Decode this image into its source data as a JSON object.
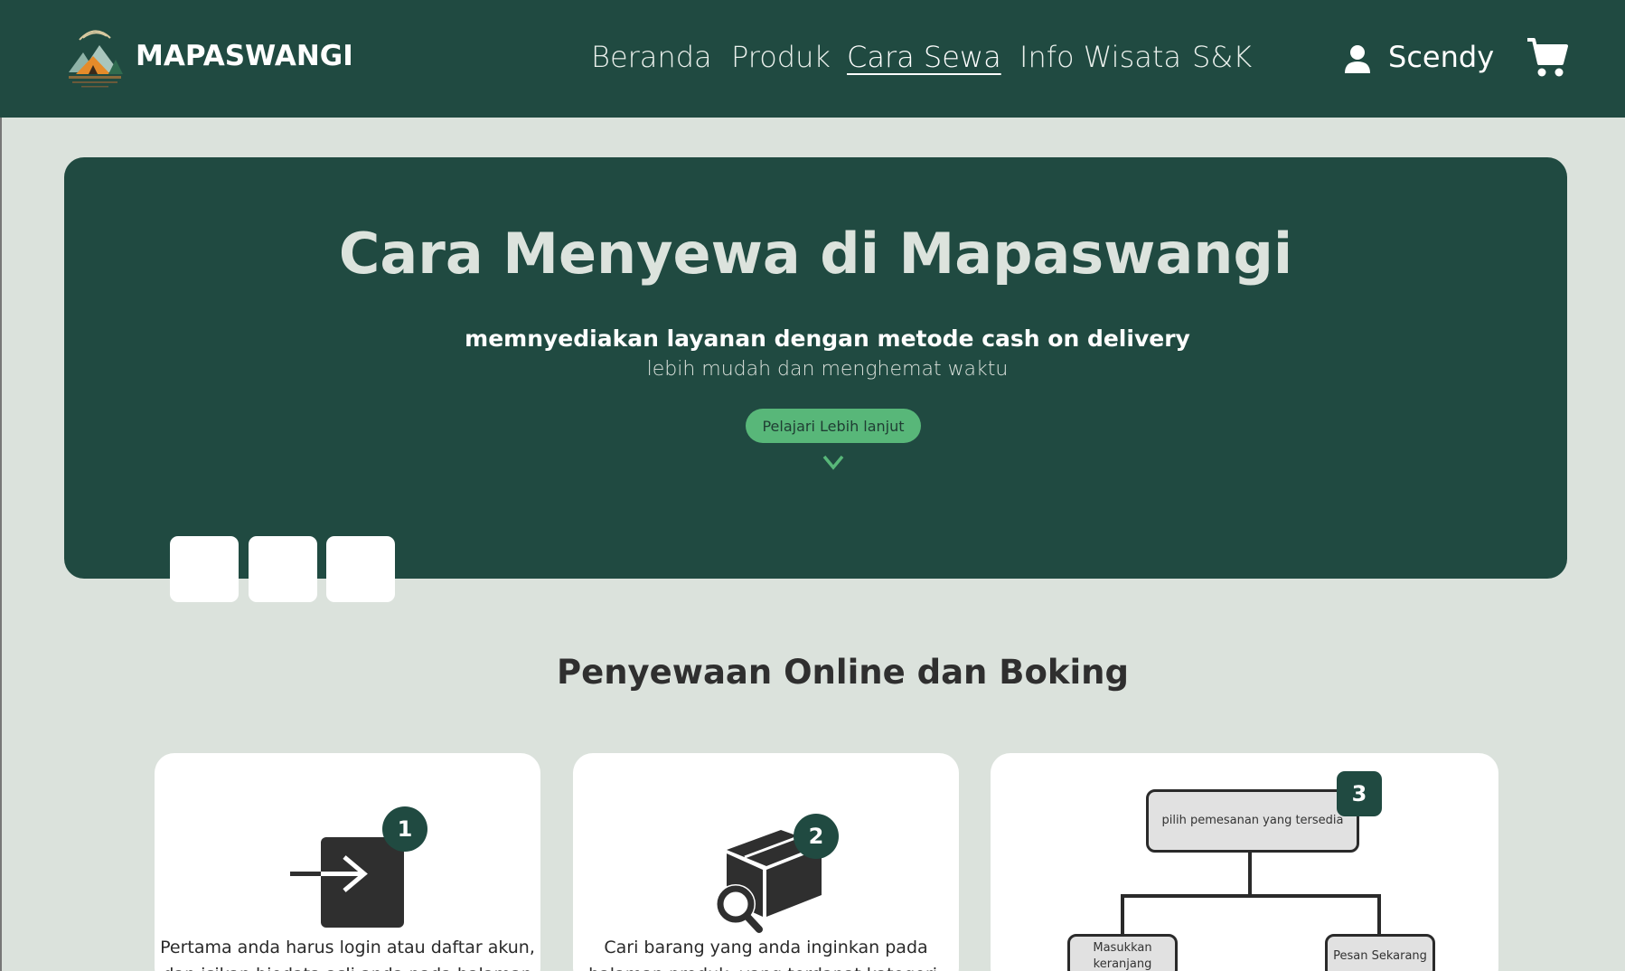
{
  "nav": {
    "brand": "MAPASWANGI",
    "links": [
      "Beranda",
      "Produk",
      "Cara Sewa",
      "Info Wisata",
      "S&K"
    ],
    "active_link": "Cara Sewa",
    "user_name": "Scendy"
  },
  "hero": {
    "title": "Cara Menyewa di Mapaswangi",
    "subtitle": "memnyediakan layanan dengan metode cash on delivery",
    "tagline": "lebih mudah dan menghemat waktu",
    "button_label": "Pelajari Lebih lanjut"
  },
  "section": {
    "title": "Penyewaan Online dan Boking"
  },
  "cards": [
    {
      "number": "1",
      "icon": "login-icon",
      "text": "Pertama anda harus login atau daftar akun, dan isikan biodata asli anda pada halaman"
    },
    {
      "number": "2",
      "icon": "box-search-icon",
      "text": "Cari barang yang anda inginkan pada halaman produk, yang terdapat kategori-"
    },
    {
      "number": "3",
      "flow": {
        "top": "pilih pemesanan yang tersedia",
        "left": "Masukkan keranjang",
        "right": "Pesan Sekarang"
      }
    }
  ],
  "colors": {
    "primary": "#204a41",
    "accent": "#58b779",
    "background": "#dbe2dc"
  }
}
